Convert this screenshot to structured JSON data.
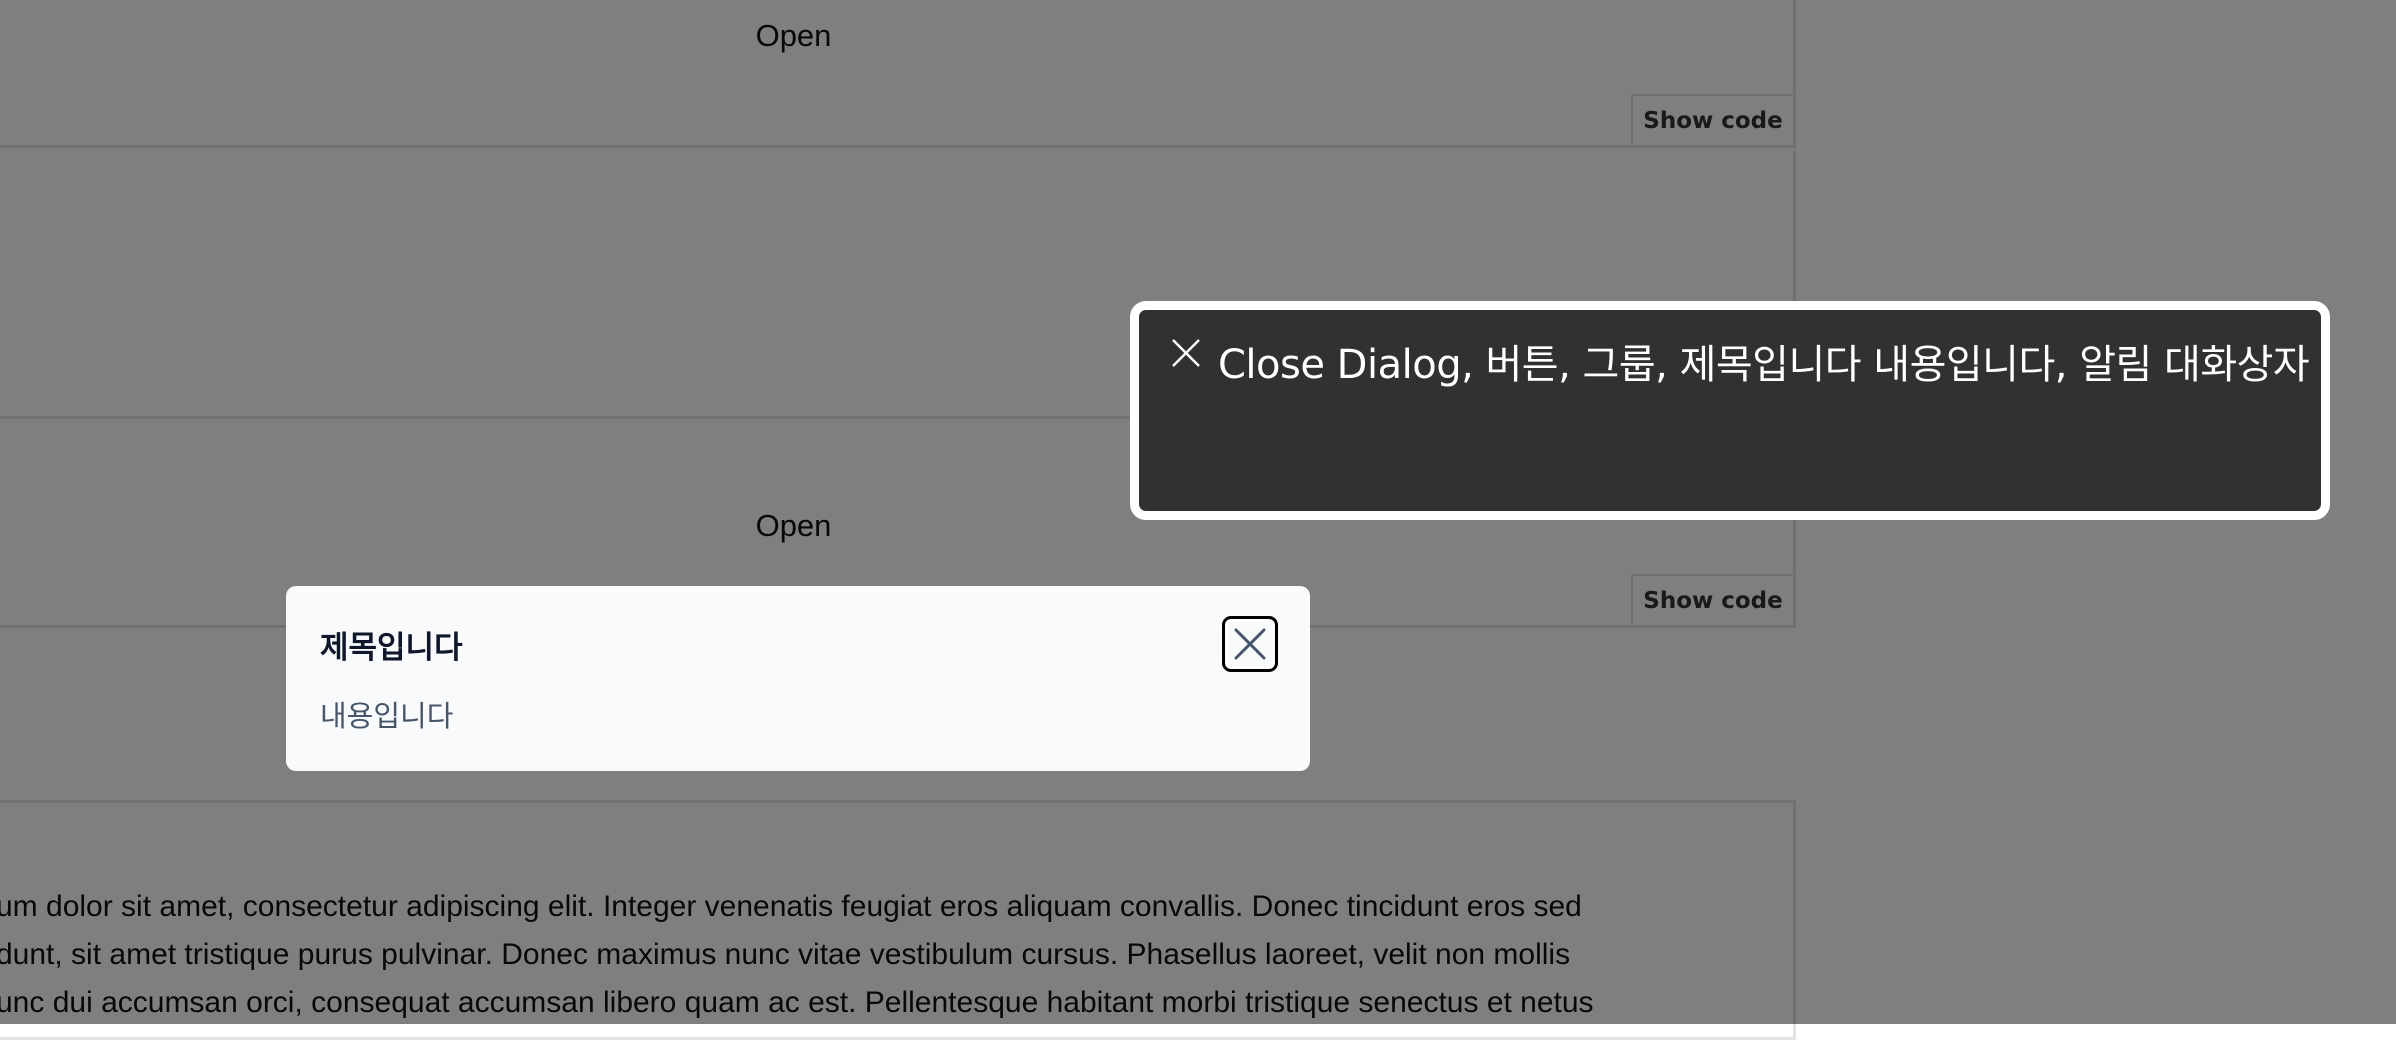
{
  "examples": {
    "open_label": "Open",
    "show_code_label": "Show code"
  },
  "lorem": {
    "lines": [
      "um dolor sit amet, consectetur adipiscing elit. Integer venenatis feugiat eros aliquam convallis. Donec tincidunt eros sed",
      "dunt, sit amet tristique purus pulvinar. Donec maximus nunc vitae vestibulum cursus. Phasellus laoreet, velit non mollis",
      "unc dui accumsan orci, consequat accumsan libero quam ac est. Pellentesque habitant morbi tristique senectus et netus"
    ]
  },
  "dialog": {
    "title": "제목입니다",
    "body": "내용입니다",
    "close_icon": "close-icon"
  },
  "screen_reader": {
    "caption": "Close Dialog, 버튼, 그룹, 제목입니다 내용입니다, 알림 대화상자",
    "icon": "close-icon"
  },
  "colors": {
    "backdrop": "rgba(0,0,0,0.5)",
    "dialog_bg": "#f8fafc",
    "caption_bg": "#313131"
  }
}
